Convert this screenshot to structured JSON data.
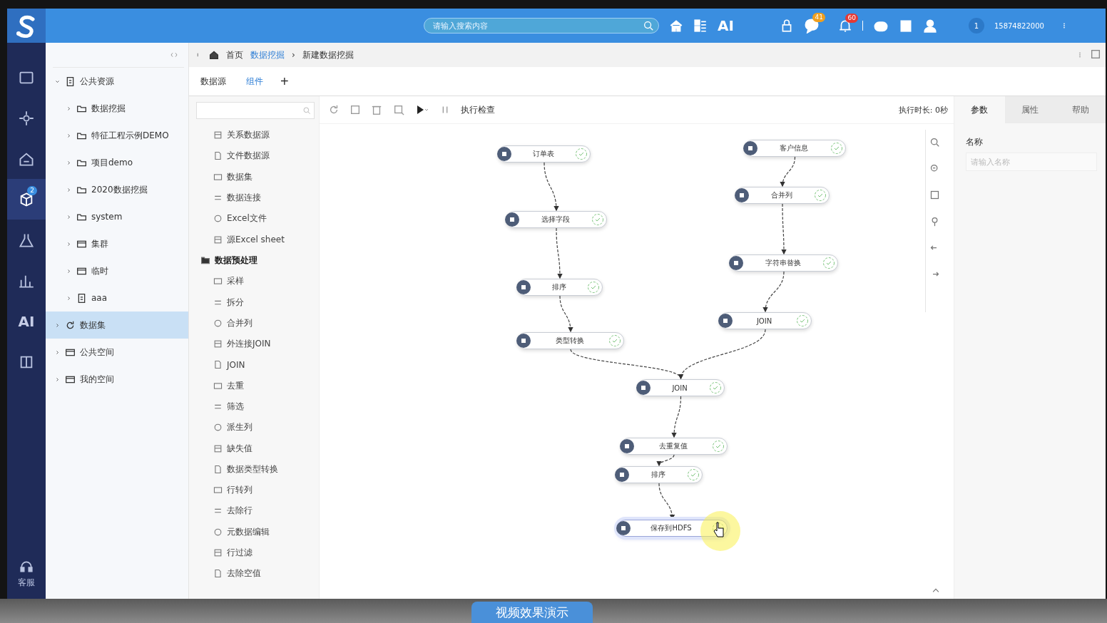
{
  "topbar": {
    "search_placeholder": "请输入搜索内容",
    "ai_label": "AI",
    "chat_badge": "41",
    "bell_badge": "60",
    "avatar_initial": "1",
    "username": "15874822000"
  },
  "sidebar": {
    "ai_label": "AI",
    "badge": "2",
    "footer_label": "客服",
    "items": [
      {
        "selected": false
      },
      {
        "selected": false
      },
      {
        "selected": false
      },
      {
        "selected": true
      },
      {
        "selected": false
      },
      {
        "selected": false
      }
    ]
  },
  "breadcrumb": [
    {
      "label": "首页",
      "kind": "home"
    },
    {
      "label": "数据挖掘",
      "kind": "link"
    },
    {
      "label": "新建数据挖掘",
      "kind": "current",
      "separator": "›"
    }
  ],
  "tabs": [
    {
      "label": "数据源",
      "selected": false
    },
    {
      "label": "组件",
      "selected": true
    }
  ],
  "add_tab": "+",
  "tree": [
    {
      "label": "公共资源",
      "kind": "doc",
      "expanded": true,
      "selected": false,
      "children": [
        {
          "label": "数据挖掘",
          "kind": "folder",
          "expanded": false,
          "selected": false
        },
        {
          "label": "特征工程示例DEMO",
          "kind": "folder",
          "expanded": false,
          "selected": false
        },
        {
          "label": "项目demo",
          "kind": "folder",
          "expanded": false,
          "selected": false
        },
        {
          "label": "2020数据挖掘",
          "kind": "folder",
          "expanded": false,
          "selected": false
        },
        {
          "label": "system",
          "kind": "folder",
          "expanded": false,
          "selected": false
        },
        {
          "label": "集群",
          "kind": "box",
          "expanded": false,
          "selected": false
        },
        {
          "label": "临时",
          "kind": "box",
          "expanded": false,
          "selected": false
        },
        {
          "label": "aaa",
          "kind": "doc",
          "expanded": false,
          "selected": false
        }
      ]
    },
    {
      "label": "数据集",
      "kind": "refresh",
      "expanded": false,
      "selected": true
    },
    {
      "label": "公共空间",
      "kind": "box",
      "expanded": false,
      "selected": false
    },
    {
      "label": "我的空间",
      "kind": "box",
      "expanded": false,
      "selected": false
    }
  ],
  "components": [
    {
      "label": "关系数据源",
      "kind": "item"
    },
    {
      "label": "文件数据源",
      "kind": "item"
    },
    {
      "label": "数据集",
      "kind": "item"
    },
    {
      "label": "数据连接",
      "kind": "item"
    },
    {
      "label": "Excel文件",
      "kind": "item"
    },
    {
      "label": "源Excel sheet",
      "kind": "item"
    },
    {
      "label": "数据预处理",
      "kind": "group"
    },
    {
      "label": "采样",
      "kind": "item"
    },
    {
      "label": "拆分",
      "kind": "item"
    },
    {
      "label": "合并列",
      "kind": "item"
    },
    {
      "label": "外连接JOIN",
      "kind": "item"
    },
    {
      "label": "JOIN",
      "kind": "item"
    },
    {
      "label": "去重",
      "kind": "item"
    },
    {
      "label": "筛选",
      "kind": "item"
    },
    {
      "label": "派生列",
      "kind": "item"
    },
    {
      "label": "缺失值",
      "kind": "item"
    },
    {
      "label": "数据类型转换",
      "kind": "item"
    },
    {
      "label": "行转列",
      "kind": "item"
    },
    {
      "label": "去除行",
      "kind": "item"
    },
    {
      "label": "元数据编辑",
      "kind": "item"
    },
    {
      "label": "行过滤",
      "kind": "item"
    },
    {
      "label": "去除空值",
      "kind": "item"
    }
  ],
  "toolbar": {
    "run_check": "执行检查",
    "duration": "执行时长: 0秒"
  },
  "flow": {
    "nodes": [
      {
        "label": "订单表",
        "selected": false
      },
      {
        "label": "选择字段",
        "selected": false
      },
      {
        "label": "排序",
        "selected": false
      },
      {
        "label": "类型转换",
        "selected": false
      },
      {
        "label": "客户信息",
        "selected": false
      },
      {
        "label": "合并列",
        "selected": false
      },
      {
        "label": "字符串替换",
        "selected": false
      },
      {
        "label": "JOIN",
        "selected": false
      },
      {
        "label": "JOIN",
        "selected": false
      },
      {
        "label": "去重复值",
        "selected": false
      },
      {
        "label": "排序",
        "selected": false
      },
      {
        "label": "保存到HDFS",
        "selected": true
      }
    ]
  },
  "props": {
    "tabs": [
      {
        "label": "参数",
        "selected": true
      },
      {
        "label": "属性",
        "selected": false
      },
      {
        "label": "帮助",
        "selected": false
      }
    ],
    "name_label": "名称",
    "name_placeholder": "请输入名称"
  },
  "bottom": {
    "caption": "视频效果演示"
  }
}
